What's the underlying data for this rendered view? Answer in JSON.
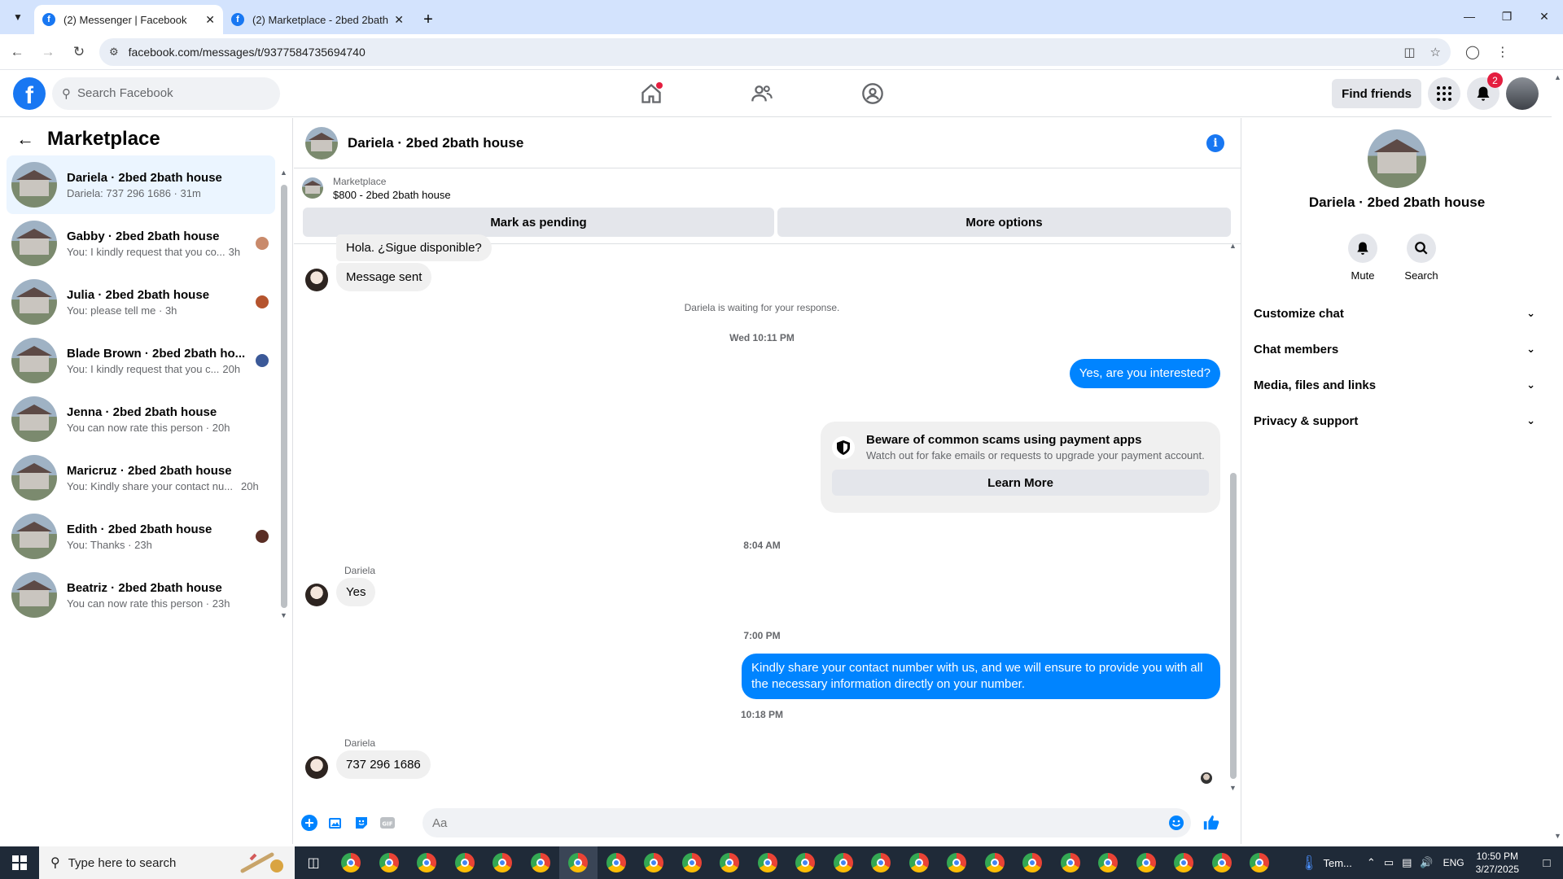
{
  "browser": {
    "tabs": [
      {
        "title": "(2) Messenger | Facebook",
        "active": true
      },
      {
        "title": "(2) Marketplace - 2bed 2bath h",
        "active": false
      }
    ],
    "url": "facebook.com/messages/t/9377584735694740"
  },
  "fb_header": {
    "search_placeholder": "Search Facebook",
    "find_friends": "Find friends",
    "notification_count": "2"
  },
  "sidebar": {
    "title": "Marketplace",
    "conversations": [
      {
        "name": "Dariela · 2bed 2bath house",
        "snippet": "Dariela: 737 296 1686",
        "time": "31m",
        "active": true,
        "seen_color": ""
      },
      {
        "name": "Gabby · 2bed 2bath house",
        "snippet": "You: I kindly request that you co...",
        "time": "3h",
        "active": false,
        "seen_color": "#c98a6b"
      },
      {
        "name": "Julia · 2bed 2bath house",
        "snippet": "You: please tell me",
        "time": "3h",
        "active": false,
        "seen_color": "#b5542e"
      },
      {
        "name": "Blade Brown · 2bed 2bath ho...",
        "snippet": "You: I kindly request that you c...",
        "time": "20h",
        "active": false,
        "seen_color": "#3b5998"
      },
      {
        "name": "Jenna · 2bed 2bath house",
        "snippet": "You can now rate this person",
        "time": "20h",
        "active": false,
        "seen_color": ""
      },
      {
        "name": "Maricruz · 2bed 2bath house",
        "snippet": "You: Kindly share your contact nu...",
        "time": "20h",
        "active": false,
        "seen_color": ""
      },
      {
        "name": "Edith · 2bed 2bath house",
        "snippet": "You: Thanks",
        "time": "23h",
        "active": false,
        "seen_color": "#5a2e25"
      },
      {
        "name": "Beatriz · 2bed 2bath house",
        "snippet": "You can now rate this person",
        "time": "23h",
        "active": false,
        "seen_color": ""
      }
    ]
  },
  "chat": {
    "title": "Dariela · 2bed 2bath house",
    "marketplace_label": "Marketplace",
    "listing": "$800 - 2bed 2bath house",
    "mark_pending": "Mark as pending",
    "more_options": "More options",
    "msg_hola": "Hola. ¿Sigue disponible?",
    "msg_sent": "Message sent",
    "waiting_note": "Dariela is waiting for your response.",
    "time1": "Wed 10:11 PM",
    "out1": "Yes, are you interested?",
    "scam_title": "Beware of common scams using payment apps",
    "scam_sub": "Watch out for fake emails or requests to upgrade your payment account.",
    "learn_more": "Learn More",
    "time2": "8:04 AM",
    "sender1": "Dariela",
    "in_yes": "Yes",
    "time3": "7:00 PM",
    "out2": "Kindly share your contact number with us, and we will ensure to provide you with all the necessary information directly on your number.",
    "time4": "10:18 PM",
    "sender2": "Dariela",
    "in_number": "737 296 1686",
    "composer_placeholder": "Aa"
  },
  "info_panel": {
    "name": "Dariela · 2bed 2bath house",
    "mute": "Mute",
    "search": "Search",
    "sections": [
      "Customize chat",
      "Chat members",
      "Media, files and links",
      "Privacy & support"
    ]
  },
  "taskbar": {
    "search_placeholder": "Type here to search",
    "weather": "Tem...",
    "lang": "ENG",
    "time": "10:50 PM",
    "date": "3/27/2025"
  }
}
